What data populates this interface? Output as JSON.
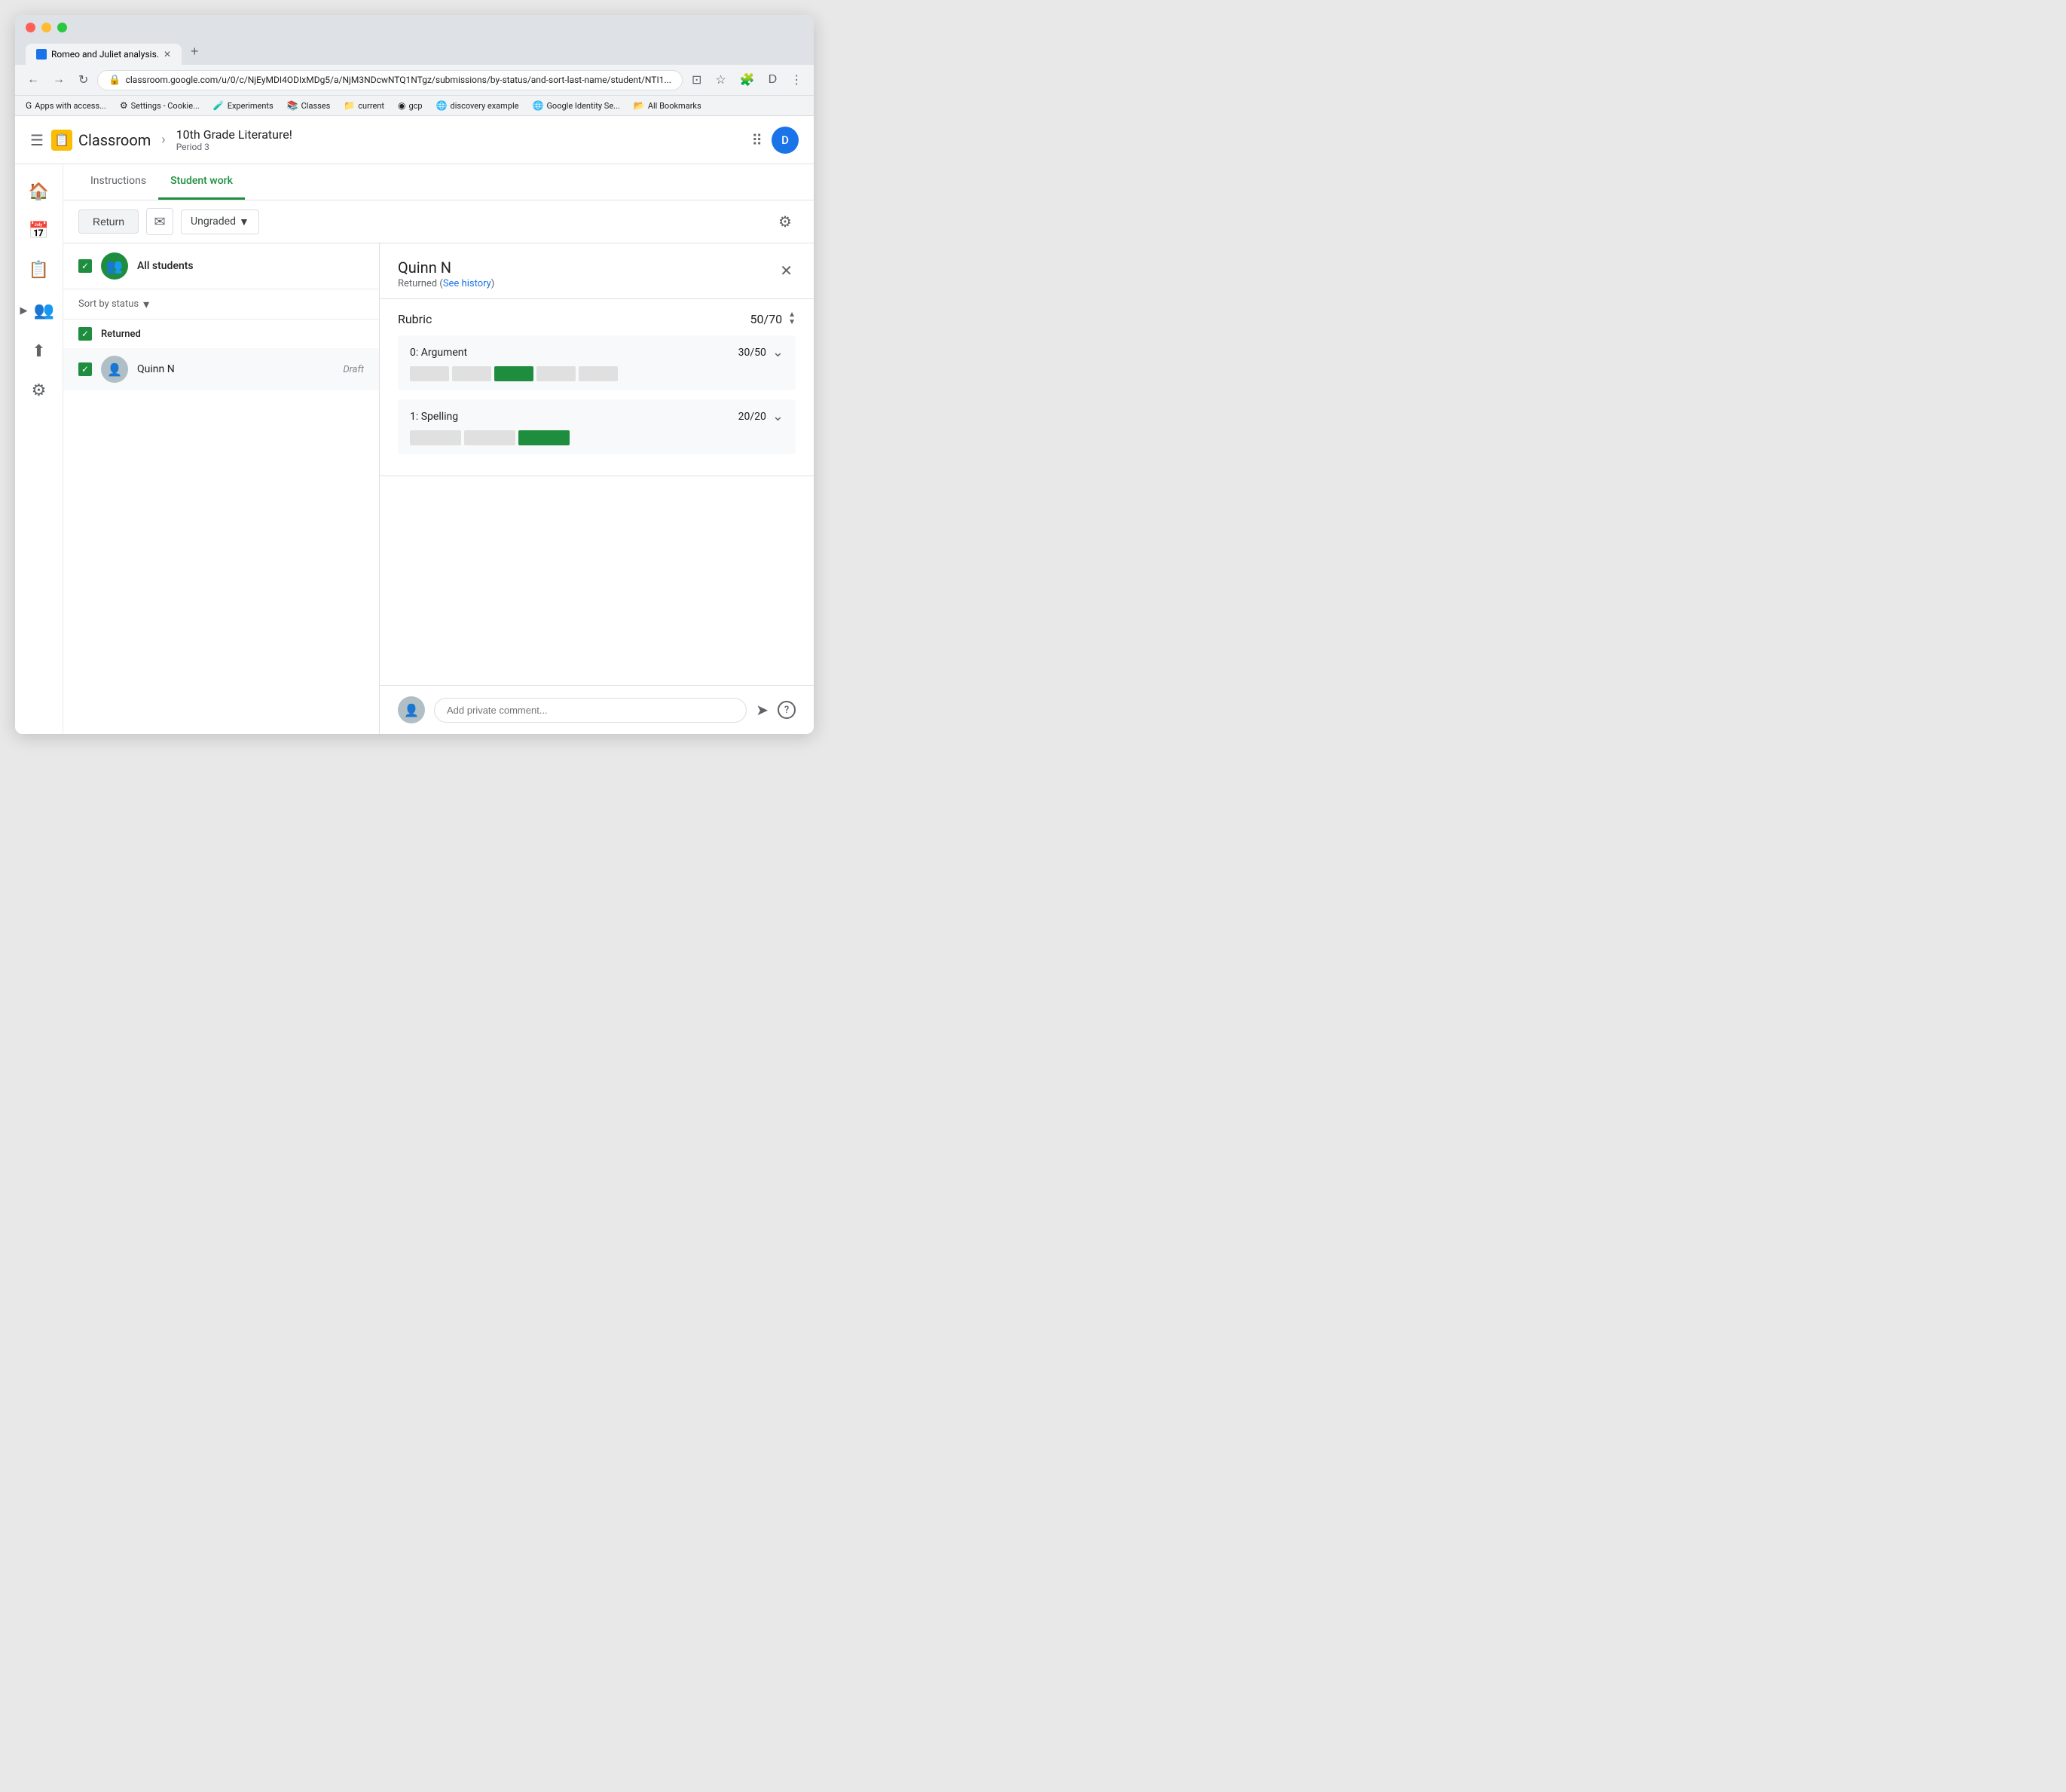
{
  "browser": {
    "tab_title": "Romeo and Juliet analysis.",
    "url": "classroom.google.com/u/0/c/NjEyMDI4ODIxMDg5/a/NjM3NDcwNTQ1NTgz/submissions/by-status/and-sort-last-name/student/NTI1...",
    "bookmarks": [
      {
        "icon": "G",
        "label": "Apps with access..."
      },
      {
        "icon": "⚙",
        "label": "Settings - Cookie..."
      },
      {
        "icon": "🧪",
        "label": "Experiments"
      },
      {
        "icon": "📚",
        "label": "Classes"
      },
      {
        "icon": "📁",
        "label": "current"
      },
      {
        "icon": "◉",
        "label": "gcp"
      },
      {
        "icon": "🌐",
        "label": "discovery example"
      },
      {
        "icon": "🌐",
        "label": "Google Identity Se..."
      },
      {
        "icon": "📂",
        "label": "All Bookmarks"
      }
    ]
  },
  "app": {
    "title": "Classroom",
    "logo_char": "📋",
    "breadcrumb": {
      "course": "10th Grade Literature!",
      "period": "Period 3"
    },
    "user_initial": "D"
  },
  "tabs": {
    "instructions": "Instructions",
    "student_work": "Student work"
  },
  "toolbar": {
    "return_label": "Return",
    "grade_filter": "Ungraded",
    "settings_title": "Settings"
  },
  "student_list": {
    "all_students_label": "All students",
    "sort_label": "Sort by status",
    "section_returned": "Returned",
    "students": [
      {
        "name": "Quinn N",
        "status": "Draft"
      }
    ]
  },
  "student_panel": {
    "name": "Quinn N",
    "status": "Returned (See history)",
    "status_link": "See history",
    "rubric_title": "Rubric",
    "rubric_score": "50",
    "rubric_max": "70",
    "criteria": [
      {
        "name": "0: Argument",
        "score": "30",
        "max": "50",
        "bar_segments": 5,
        "selected_segment": 3
      },
      {
        "name": "1: Spelling",
        "score": "20",
        "max": "20",
        "bar_segments": 3,
        "selected_segment": 3
      }
    ],
    "comment_placeholder": "Add private comment..."
  }
}
